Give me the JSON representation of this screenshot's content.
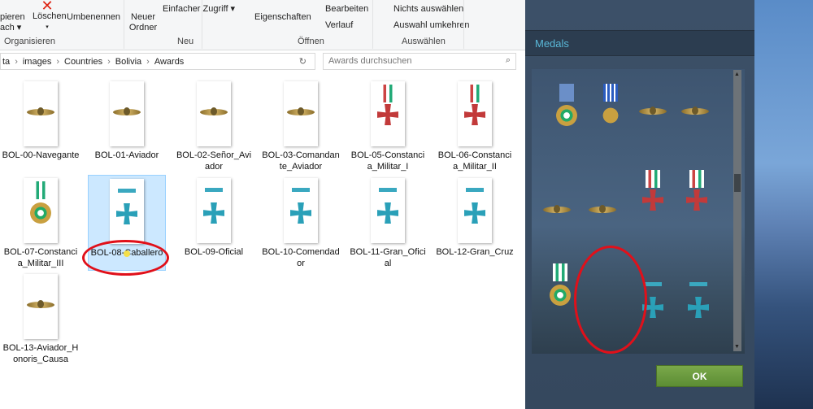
{
  "ribbon": {
    "kopieren": "pieren",
    "nach": "ach ▾",
    "loeschen": "Löschen",
    "umbenennen": "Umbenennen",
    "neuer_ordner": "Neuer Ordner",
    "einfacher_zugriff": "Einfacher Zugriff ▾",
    "eigenschaften": "Eigenschaften",
    "bearbeiten": "Bearbeiten",
    "verlauf": "Verlauf",
    "nichts_auswaehlen": "Nichts auswählen",
    "auswahl_umkehren": "Auswahl umkehren",
    "groups": [
      "Organisieren",
      "Neu",
      "Öffnen",
      "Auswählen"
    ]
  },
  "address": {
    "crumbs": [
      "ta",
      "images",
      "Countries",
      "Bolivia",
      "Awards"
    ],
    "search_placeholder": "Awards durchsuchen"
  },
  "files": [
    {
      "name": "BOL-00-Navegante",
      "type": "wings"
    },
    {
      "name": "BOL-01-Aviador",
      "type": "wings"
    },
    {
      "name": "BOL-02-Señor_Aviador",
      "type": "wings"
    },
    {
      "name": "BOL-03-Comandante_Aviador",
      "type": "wings"
    },
    {
      "name": "BOL-05-Constancia_Militar_I",
      "type": "cross"
    },
    {
      "name": "BOL-06-Constancia_Militar_II",
      "type": "cross"
    },
    {
      "name": "BOL-07-Constancia_Militar_III",
      "type": "star"
    },
    {
      "name": "BOL-08-Caballero",
      "type": "blue",
      "selected": true
    },
    {
      "name": "BOL-09-Oficial",
      "type": "blue"
    },
    {
      "name": "BOL-10-Comendador",
      "type": "blue"
    },
    {
      "name": "BOL-11-Gran_Oficial",
      "type": "blue"
    },
    {
      "name": "BOL-12-Gran_Cruz",
      "type": "blue"
    },
    {
      "name": "BOL-13-Aviador_Honoris_Causa",
      "type": "wings"
    }
  ],
  "game": {
    "section_title": "Medals",
    "ok_label": "OK"
  }
}
